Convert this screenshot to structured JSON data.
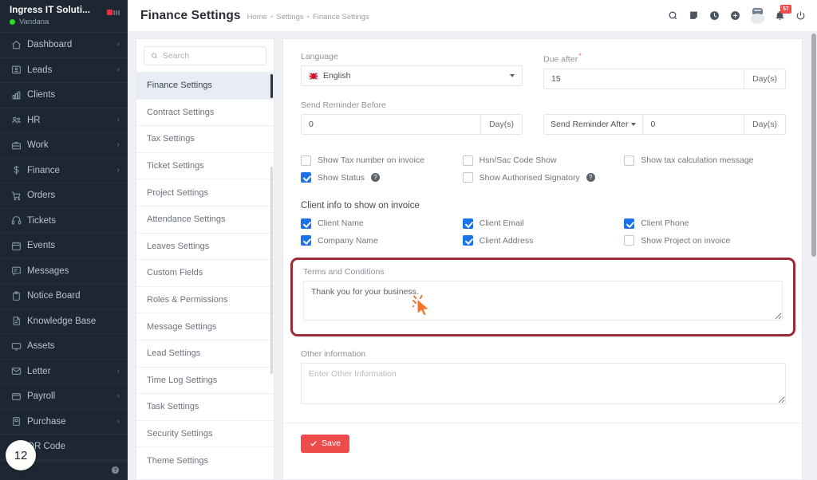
{
  "sidebar": {
    "brand_name": "Ingress IT Soluti...",
    "user_name": "Vandana",
    "step_badge": "12",
    "items": [
      {
        "label": "Dashboard",
        "icon": "home-icon",
        "caret": "›"
      },
      {
        "label": "Leads",
        "icon": "leads-icon",
        "caret": "›"
      },
      {
        "label": "Clients",
        "icon": "clients-icon",
        "caret": ""
      },
      {
        "label": "HR",
        "icon": "hr-icon",
        "caret": "›"
      },
      {
        "label": "Work",
        "icon": "work-icon",
        "caret": "›"
      },
      {
        "label": "Finance",
        "icon": "finance-icon",
        "caret": "›"
      },
      {
        "label": "Orders",
        "icon": "orders-icon",
        "caret": ""
      },
      {
        "label": "Tickets",
        "icon": "tickets-icon",
        "caret": ""
      },
      {
        "label": "Events",
        "icon": "events-icon",
        "caret": ""
      },
      {
        "label": "Messages",
        "icon": "messages-icon",
        "caret": ""
      },
      {
        "label": "Notice Board",
        "icon": "notice-board-icon",
        "caret": ""
      },
      {
        "label": "Knowledge Base",
        "icon": "knowledge-base-icon",
        "caret": ""
      },
      {
        "label": "Assets",
        "icon": "assets-icon",
        "caret": ""
      },
      {
        "label": "Letter",
        "icon": "letter-icon",
        "caret": "›"
      },
      {
        "label": "Payroll",
        "icon": "payroll-icon",
        "caret": "›"
      },
      {
        "label": "Purchase",
        "icon": "purchase-icon",
        "caret": "›"
      },
      {
        "label": "QR Code",
        "icon": "qr-code-icon",
        "caret": ""
      }
    ]
  },
  "topbar": {
    "title": "Finance Settings",
    "breadcrumbs": [
      "Home",
      "Settings",
      "Finance Settings"
    ],
    "separator": "•",
    "notification_count": "57",
    "icons": [
      "search-icon",
      "note-icon",
      "clock-icon",
      "plus-icon",
      "gift-icon",
      "bell-icon",
      "power-icon"
    ]
  },
  "settings_menu": {
    "search_placeholder": "Search",
    "search_value": "",
    "active": "Finance Settings",
    "items": [
      "Finance Settings",
      "Contract Settings",
      "Tax Settings",
      "Ticket Settings",
      "Project Settings",
      "Attendance Settings",
      "Leaves Settings",
      "Custom Fields",
      "Roles & Permissions",
      "Message Settings",
      "Lead Settings",
      "Time Log Settings",
      "Task Settings",
      "Security Settings",
      "Theme Settings"
    ]
  },
  "form": {
    "language": {
      "label": "Language",
      "value": "English",
      "flag": "uk-flag-icon"
    },
    "due_after": {
      "label": "Due after",
      "required": "*",
      "value": "15",
      "suffix": "Day(s)"
    },
    "send_reminder_before": {
      "label": "Send Reminder Before",
      "value": "0",
      "suffix": "Day(s)"
    },
    "send_reminder_after": {
      "dropdown_label": "Send Reminder After",
      "value": "0",
      "suffix": "Day(s)"
    },
    "checkboxes": [
      {
        "label": "Show Tax number on invoice",
        "checked": false,
        "help": false
      },
      {
        "label": "Hsn/Sac Code Show",
        "checked": false,
        "help": false
      },
      {
        "label": "Show tax calculation message",
        "checked": false,
        "help": false
      },
      {
        "label": "Show Status",
        "checked": true,
        "help": true
      },
      {
        "label": "Show Authorised Signatory",
        "checked": false,
        "help": true
      }
    ],
    "client_info": {
      "heading": "Client info to show on invoice",
      "items": [
        {
          "label": "Client Name",
          "checked": true
        },
        {
          "label": "Client Email",
          "checked": true
        },
        {
          "label": "Client Phone",
          "checked": true
        },
        {
          "label": "Company Name",
          "checked": true
        },
        {
          "label": "Client Address",
          "checked": true
        },
        {
          "label": "Show Project on invoice",
          "checked": false
        }
      ]
    },
    "terms": {
      "label": "Terms and Conditions",
      "value": "Thank you for your business.",
      "placeholder": ""
    },
    "other_info": {
      "label": "Other information",
      "value": "",
      "placeholder": "Enter Other Information"
    },
    "save_label": "Save",
    "help_glyph": "?"
  },
  "colors": {
    "sidebar_bg": "#1c2733",
    "accent_red": "#ef4b4b",
    "highlight_border": "#9e2a35",
    "checkbox_blue": "#1a73e8",
    "cursor_orange": "#f4762b"
  }
}
